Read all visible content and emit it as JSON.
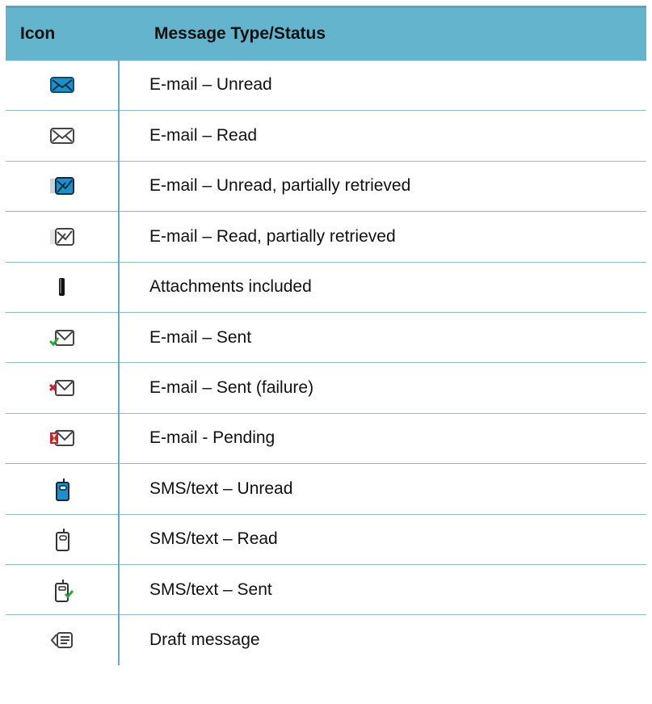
{
  "table": {
    "headers": {
      "icon": "Icon",
      "type": "Message Type/Status"
    },
    "rows": [
      {
        "icon": "email-unread-icon",
        "label": "E-mail – Unread"
      },
      {
        "icon": "email-read-icon",
        "label": "E-mail – Read"
      },
      {
        "icon": "email-unread-partial-icon",
        "label": "E-mail – Unread, partially retrieved"
      },
      {
        "icon": "email-read-partial-icon",
        "label": "E-mail – Read, partially retrieved"
      },
      {
        "icon": "attachment-icon",
        "label": "Attachments included"
      },
      {
        "icon": "email-sent-icon",
        "label": "E-mail – Sent"
      },
      {
        "icon": "email-sent-failure-icon",
        "label": "E-mail – Sent (failure)"
      },
      {
        "icon": "email-pending-icon",
        "label": "E-mail - Pending"
      },
      {
        "icon": "sms-unread-icon",
        "label": "SMS/text – Unread"
      },
      {
        "icon": "sms-read-icon",
        "label": "SMS/text – Read"
      },
      {
        "icon": "sms-sent-icon",
        "label": "SMS/text – Sent"
      },
      {
        "icon": "draft-message-icon",
        "label": "Draft message"
      }
    ]
  },
  "colors": {
    "header_bg": "#64b4cd",
    "rule": "#8fb8c8",
    "icon_blue": "#1f8fc9",
    "success_green": "#2aa63a",
    "failure_red": "#c4243a"
  }
}
